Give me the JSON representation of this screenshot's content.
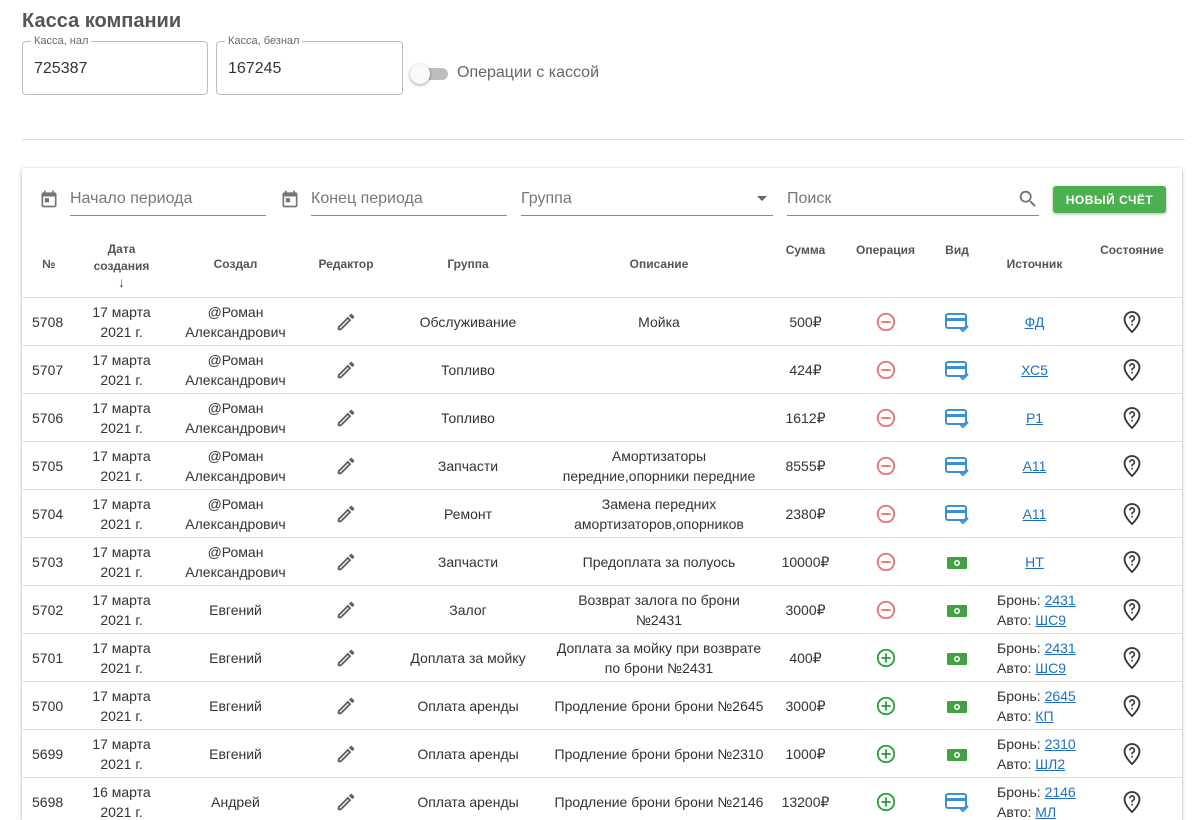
{
  "page_title": "Касса компании",
  "cash": {
    "label": "Касса, нал",
    "value": "725387"
  },
  "noncash": {
    "label": "Касса, безнал",
    "value": "167245"
  },
  "toggle_label": "Операции с кассой",
  "filters": {
    "start_placeholder": "Начало периода",
    "end_placeholder": "Конец периода",
    "group_placeholder": "Группа",
    "search_placeholder": "Поиск",
    "new_button": "НОВЫЙ СЧЁТ"
  },
  "columns": {
    "num": "№",
    "created_line1": "Дата",
    "created_line2": "создания",
    "sort_arrow": "↓",
    "creator": "Создал",
    "editor": "Редактор",
    "group": "Группа",
    "description": "Описание",
    "sum": "Сумма",
    "operation": "Операция",
    "kind": "Вид",
    "source": "Источник",
    "state": "Состояние"
  },
  "colors": {
    "minus": "#e57373",
    "plus": "#2e9e3e",
    "card": "#3b8fd9",
    "cash": "#43a047",
    "button": "#4caf50",
    "link": "#1f6fc4"
  },
  "rows": [
    {
      "id": "5708",
      "date1": "17 марта",
      "date2": "2021 г.",
      "creator1": "@Роман",
      "creator2": "Александрович",
      "group": "Обслуживание",
      "desc1": "Мойка",
      "desc2": "",
      "sum": "500₽",
      "op": "minus",
      "kind": "card",
      "src_link": "ФД",
      "src_b_label": "",
      "src_b_link": "",
      "src_a_label": "",
      "src_a_link": ""
    },
    {
      "id": "5707",
      "date1": "17 марта",
      "date2": "2021 г.",
      "creator1": "@Роман",
      "creator2": "Александрович",
      "group": "Топливо",
      "desc1": "",
      "desc2": "",
      "sum": "424₽",
      "op": "minus",
      "kind": "card",
      "src_link": "ХС5",
      "src_b_label": "",
      "src_b_link": "",
      "src_a_label": "",
      "src_a_link": ""
    },
    {
      "id": "5706",
      "date1": "17 марта",
      "date2": "2021 г.",
      "creator1": "@Роман",
      "creator2": "Александрович",
      "group": "Топливо",
      "desc1": "",
      "desc2": "",
      "sum": "1612₽",
      "op": "minus",
      "kind": "card",
      "src_link": "Р1",
      "src_b_label": "",
      "src_b_link": "",
      "src_a_label": "",
      "src_a_link": ""
    },
    {
      "id": "5705",
      "date1": "17 марта",
      "date2": "2021 г.",
      "creator1": "@Роман",
      "creator2": "Александрович",
      "group": "Запчасти",
      "desc1": "Амортизаторы",
      "desc2": "передние,опорники передние",
      "sum": "8555₽",
      "op": "minus",
      "kind": "card",
      "src_link": "А11",
      "src_b_label": "",
      "src_b_link": "",
      "src_a_label": "",
      "src_a_link": ""
    },
    {
      "id": "5704",
      "date1": "17 марта",
      "date2": "2021 г.",
      "creator1": "@Роман",
      "creator2": "Александрович",
      "group": "Ремонт",
      "desc1": "Замена передних",
      "desc2": "амортизаторов,опорников",
      "sum": "2380₽",
      "op": "minus",
      "kind": "card",
      "src_link": "А11",
      "src_b_label": "",
      "src_b_link": "",
      "src_a_label": "",
      "src_a_link": ""
    },
    {
      "id": "5703",
      "date1": "17 марта",
      "date2": "2021 г.",
      "creator1": "@Роман",
      "creator2": "Александрович",
      "group": "Запчасти",
      "desc1": "Предоплата за полуось",
      "desc2": "",
      "sum": "10000₽",
      "op": "minus",
      "kind": "cash",
      "src_link": "НТ",
      "src_b_label": "",
      "src_b_link": "",
      "src_a_label": "",
      "src_a_link": ""
    },
    {
      "id": "5702",
      "date1": "17 марта",
      "date2": "2021 г.",
      "creator1": "Евгений",
      "creator2": "",
      "group": "Залог",
      "desc1": "Возврат залога по брони",
      "desc2": "№2431",
      "sum": "3000₽",
      "op": "minus",
      "kind": "cash",
      "src_link": "",
      "src_b_label": "Бронь: ",
      "src_b_link": "2431",
      "src_a_label": "Авто: ",
      "src_a_link": "ШС9"
    },
    {
      "id": "5701",
      "date1": "17 марта",
      "date2": "2021 г.",
      "creator1": "Евгений",
      "creator2": "",
      "group": "Доплата за мойку",
      "desc1": "Доплата за мойку при возврате",
      "desc2": "по брони №2431",
      "sum": "400₽",
      "op": "plus",
      "kind": "cash",
      "src_link": "",
      "src_b_label": "Бронь: ",
      "src_b_link": "2431",
      "src_a_label": "Авто: ",
      "src_a_link": "ШС9"
    },
    {
      "id": "5700",
      "date1": "17 марта",
      "date2": "2021 г.",
      "creator1": "Евгений",
      "creator2": "",
      "group": "Оплата аренды",
      "desc1": "Продление брони брони №2645",
      "desc2": "",
      "sum": "3000₽",
      "op": "plus",
      "kind": "cash",
      "src_link": "",
      "src_b_label": "Бронь: ",
      "src_b_link": "2645",
      "src_a_label": "Авто: ",
      "src_a_link": "КП"
    },
    {
      "id": "5699",
      "date1": "17 марта",
      "date2": "2021 г.",
      "creator1": "Евгений",
      "creator2": "",
      "group": "Оплата аренды",
      "desc1": "Продление брони брони №2310",
      "desc2": "",
      "sum": "1000₽",
      "op": "plus",
      "kind": "cash",
      "src_link": "",
      "src_b_label": "Бронь: ",
      "src_b_link": "2310",
      "src_a_label": "Авто: ",
      "src_a_link": "ШЛ2"
    },
    {
      "id": "5698",
      "date1": "16 марта",
      "date2": "2021 г.",
      "creator1": "Андрей",
      "creator2": "",
      "group": "Оплата аренды",
      "desc1": "Продление брони брони №2146",
      "desc2": "",
      "sum": "13200₽",
      "op": "plus",
      "kind": "card",
      "src_link": "",
      "src_b_label": "Бронь: ",
      "src_b_link": "2146",
      "src_a_label": "Авто: ",
      "src_a_link": "МЛ"
    }
  ]
}
